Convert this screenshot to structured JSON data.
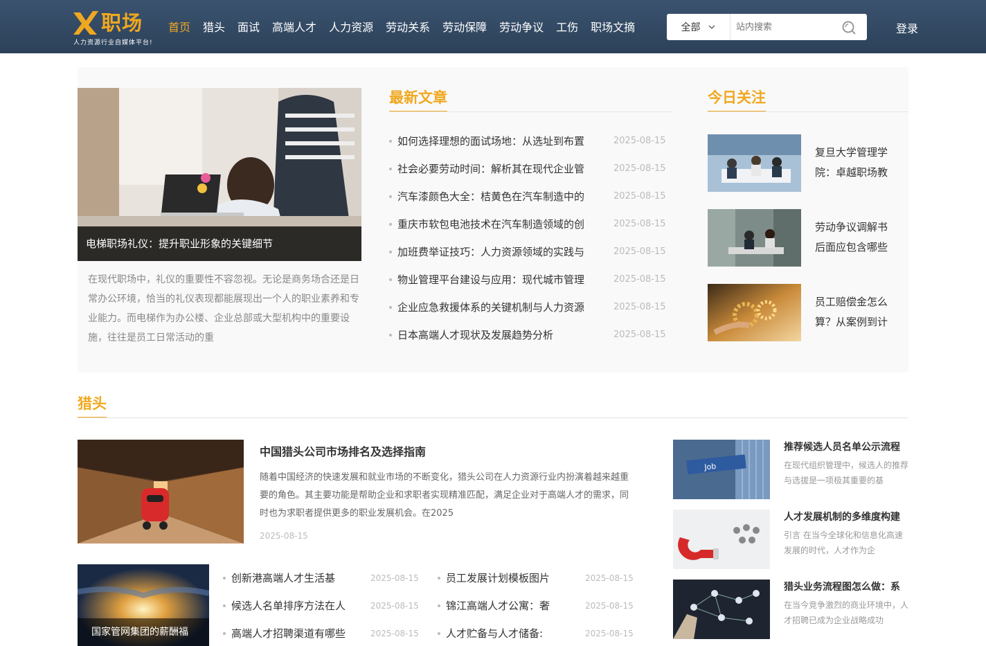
{
  "header": {
    "logo_text": "职场",
    "logo_slogan": "人力资源行业自媒体平台!",
    "nav": [
      {
        "label": "首页",
        "active": true
      },
      {
        "label": "猎头"
      },
      {
        "label": "面试"
      },
      {
        "label": "高端人才"
      },
      {
        "label": "人力资源"
      },
      {
        "label": "劳动关系"
      },
      {
        "label": "劳动保障"
      },
      {
        "label": "劳动争议"
      },
      {
        "label": "工伤"
      },
      {
        "label": "职场文摘"
      }
    ],
    "search": {
      "scope": "全部",
      "placeholder": "站内搜索"
    },
    "login": "登录",
    "accent_color": "#f0a820",
    "header_color": "#34495f"
  },
  "featured": {
    "caption": "电梯职场礼仪：提升职业形象的关键细节",
    "summary": "在现代职场中，礼仪的重要性不容忽视。无论是商务场合还是日常办公环境，恰当的礼仪表现都能展现出一个人的职业素养和专业能力。而电梯作为办公楼、企业总部或大型机构中的重要设施，往往是员工日常活动的重"
  },
  "latest": {
    "title": "最新文章",
    "items": [
      {
        "title": "如何选择理想的面试场地：从选址到布置",
        "date": "2025-08-15"
      },
      {
        "title": "社会必要劳动时间：解析其在现代企业管",
        "date": "2025-08-15"
      },
      {
        "title": "汽车漆颜色大全：桔黄色在汽车制造中的",
        "date": "2025-08-15"
      },
      {
        "title": "重庆市软包电池技术在汽车制造领域的创",
        "date": "2025-08-15"
      },
      {
        "title": "加班费举证技巧：人力资源领域的实践与",
        "date": "2025-08-15"
      },
      {
        "title": "物业管理平台建设与应用：现代城市管理",
        "date": "2025-08-15"
      },
      {
        "title": "企业应急救援体系的关键机制与人力资源",
        "date": "2025-08-15"
      },
      {
        "title": "日本高端人才现状及发展趋势分析",
        "date": "2025-08-15"
      }
    ]
  },
  "today": {
    "title": "今日关注",
    "items": [
      {
        "title": "复旦大学管理学院：卓越职场教"
      },
      {
        "title": "劳动争议调解书后面应包含哪些"
      },
      {
        "title": "员工赔偿金怎么算？从案例到计"
      }
    ]
  },
  "headhunter": {
    "title": "猎头",
    "main": {
      "title": "中国猎头公司市场排名及选择指南",
      "summary": "随着中国经济的快速发展和就业市场的不断变化，猎头公司在人力资源行业内扮演着越来越重要的角色。其主要功能是帮助企业和求职者实现精准匹配，满足企业对于高端人才的需求，同时也为求职者提供更多的职业发展机会。在2025",
      "date": "2025-08-15"
    },
    "small_feature": {
      "caption": "国家管网集团的薪酬福"
    },
    "list_left": [
      {
        "title": "创新港高端人才生活基",
        "date": "2025-08-15"
      },
      {
        "title": "候选人名单排序方法在人",
        "date": "2025-08-15"
      },
      {
        "title": "高端人才招聘渠道有哪些",
        "date": "2025-08-15"
      }
    ],
    "list_right": [
      {
        "title": "员工发展计划模板图片",
        "date": "2025-08-15"
      },
      {
        "title": "锦江高端人才公寓：奢",
        "date": "2025-08-15"
      },
      {
        "title": "人才贮备与人才储备:",
        "date": "2025-08-15"
      }
    ],
    "side": [
      {
        "title": "推荐候选人员名单公示流程",
        "summary": "在现代组织管理中，候选人的推荐与选拔是一项极其重要的基"
      },
      {
        "title": "人才发展机制的多维度构建",
        "summary": "引言 在当今全球化和信息化高速发展的时代，人才作为企"
      },
      {
        "title": "猎头业务流程图怎么做：系",
        "summary": "在当今竞争激烈的商业环境中，人才招聘已成为企业战略成功"
      }
    ],
    "job_sign": "Job"
  }
}
